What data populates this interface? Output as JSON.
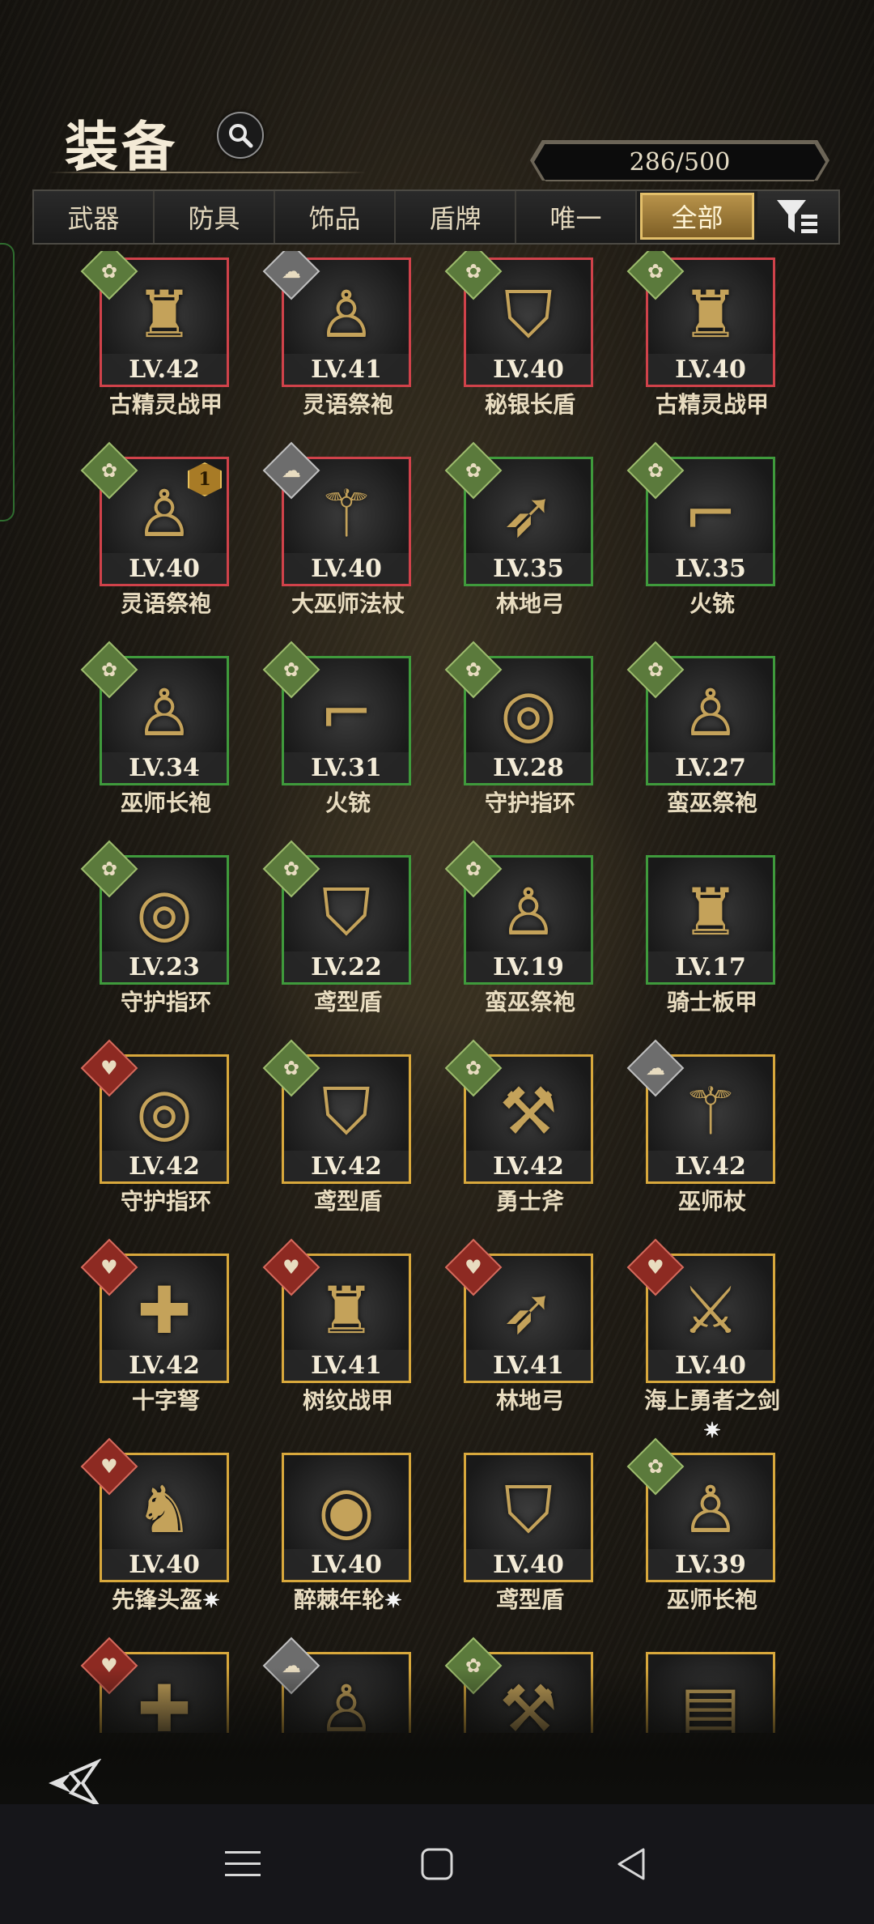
{
  "header": {
    "title": "装备",
    "capacity": "286/500"
  },
  "tabs": [
    {
      "label": "武器",
      "active": false
    },
    {
      "label": "防具",
      "active": false
    },
    {
      "label": "饰品",
      "active": false
    },
    {
      "label": "盾牌",
      "active": false
    },
    {
      "label": "唯一",
      "active": false
    },
    {
      "label": "全部",
      "active": true
    }
  ],
  "colors": {
    "red": "#d0424a",
    "green": "#3f9a3c",
    "gold": "#d8a83c",
    "tab_active": "#b8934a"
  },
  "items": [
    {
      "name": "古精灵战甲",
      "level": "LV.42",
      "frame": "red",
      "badge": "green",
      "icon": "armor-icon"
    },
    {
      "name": "灵语祭袍",
      "level": "LV.41",
      "frame": "red",
      "badge": "gray",
      "icon": "robe-icon"
    },
    {
      "name": "秘银长盾",
      "level": "LV.40",
      "frame": "red",
      "badge": "green",
      "icon": "shield-icon"
    },
    {
      "name": "古精灵战甲",
      "level": "LV.40",
      "frame": "red",
      "badge": "green",
      "icon": "armor-icon"
    },
    {
      "name": "灵语祭袍",
      "level": "LV.40",
      "frame": "red",
      "badge": "green",
      "icon": "robe-icon",
      "rank": "1"
    },
    {
      "name": "大巫师法杖",
      "level": "LV.40",
      "frame": "red",
      "badge": "gray",
      "icon": "staff-icon"
    },
    {
      "name": "林地弓",
      "level": "LV.35",
      "frame": "green",
      "badge": "green",
      "icon": "bow-icon"
    },
    {
      "name": "火铳",
      "level": "LV.35",
      "frame": "green",
      "badge": "green",
      "icon": "gun-icon"
    },
    {
      "name": "巫师长袍",
      "level": "LV.34",
      "frame": "green",
      "badge": "green",
      "icon": "robe-icon"
    },
    {
      "name": "火铳",
      "level": "LV.31",
      "frame": "green",
      "badge": "green",
      "icon": "gun-icon"
    },
    {
      "name": "守护指环",
      "level": "LV.28",
      "frame": "green",
      "badge": "green",
      "icon": "ring-icon"
    },
    {
      "name": "蛮巫祭袍",
      "level": "LV.27",
      "frame": "green",
      "badge": "green",
      "icon": "robe-icon"
    },
    {
      "name": "守护指环",
      "level": "LV.23",
      "frame": "green",
      "badge": "green",
      "icon": "ring-icon"
    },
    {
      "name": "鸢型盾",
      "level": "LV.22",
      "frame": "green",
      "badge": "green",
      "icon": "shield-icon"
    },
    {
      "name": "蛮巫祭袍",
      "level": "LV.19",
      "frame": "green",
      "badge": "green",
      "icon": "robe-icon"
    },
    {
      "name": "骑士板甲",
      "level": "LV.17",
      "frame": "green",
      "badge": "",
      "icon": "armor-icon"
    },
    {
      "name": "守护指环",
      "level": "LV.42",
      "frame": "gold",
      "badge": "red",
      "icon": "ring-icon"
    },
    {
      "name": "鸢型盾",
      "level": "LV.42",
      "frame": "gold",
      "badge": "green",
      "icon": "shield-icon"
    },
    {
      "name": "勇士斧",
      "level": "LV.42",
      "frame": "gold",
      "badge": "green",
      "icon": "axe-icon"
    },
    {
      "name": "巫师杖",
      "level": "LV.42",
      "frame": "gold",
      "badge": "gray",
      "icon": "staff-icon"
    },
    {
      "name": "十字弩",
      "level": "LV.42",
      "frame": "gold",
      "badge": "red",
      "icon": "crossbow-icon"
    },
    {
      "name": "树纹战甲",
      "level": "LV.41",
      "frame": "gold",
      "badge": "red",
      "icon": "armor-icon"
    },
    {
      "name": "林地弓",
      "level": "LV.41",
      "frame": "gold",
      "badge": "red",
      "icon": "bow-icon"
    },
    {
      "name": "海上勇者之剑",
      "level": "LV.40",
      "frame": "gold",
      "badge": "red",
      "icon": "sword-icon",
      "sparkle": "✷"
    },
    {
      "name": "先锋头盔",
      "level": "LV.40",
      "frame": "gold",
      "badge": "red",
      "icon": "helmet-icon",
      "sparkle": "✷"
    },
    {
      "name": "醉棘年轮",
      "level": "LV.40",
      "frame": "gold",
      "badge": "",
      "icon": "round-shield-icon",
      "sparkle": "✷"
    },
    {
      "name": "鸢型盾",
      "level": "LV.40",
      "frame": "gold",
      "badge": "",
      "icon": "shield-icon"
    },
    {
      "name": "巫师长袍",
      "level": "LV.39",
      "frame": "gold",
      "badge": "green",
      "icon": "robe-icon"
    },
    {
      "name": "",
      "level": "",
      "frame": "gold",
      "badge": "red",
      "icon": "crossbow-icon"
    },
    {
      "name": "",
      "level": "",
      "frame": "gold",
      "badge": "gray",
      "icon": "robe-icon"
    },
    {
      "name": "",
      "level": "",
      "frame": "gold",
      "badge": "green",
      "icon": "axe-icon"
    },
    {
      "name": "",
      "level": "",
      "frame": "gold",
      "badge": "",
      "icon": "book-icon"
    }
  ]
}
